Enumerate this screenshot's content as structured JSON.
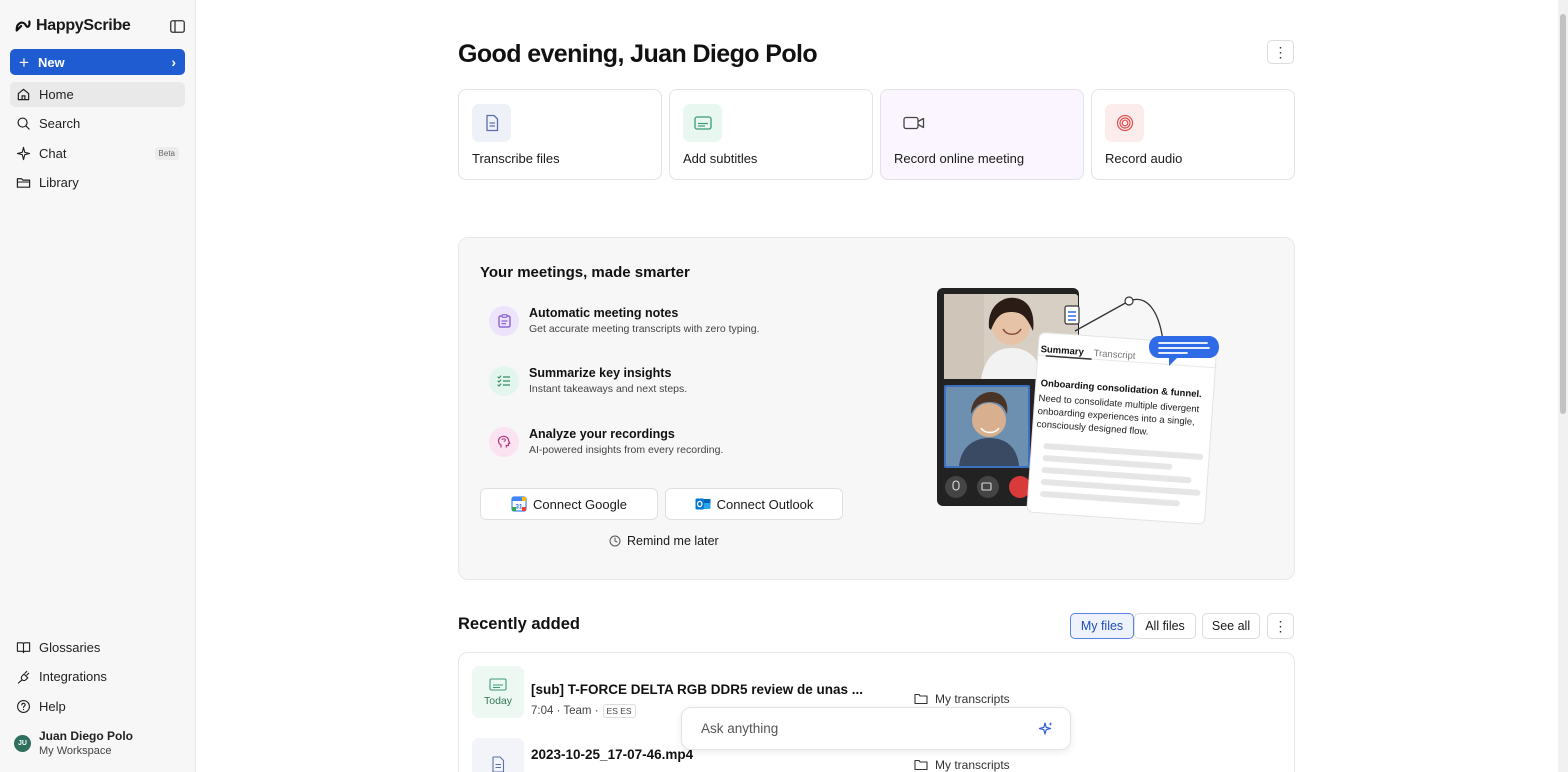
{
  "app": {
    "name": "HappyScribe"
  },
  "sidebar": {
    "new_label": "New",
    "nav": [
      {
        "label": "Home",
        "icon": "home-icon",
        "active": true
      },
      {
        "label": "Search",
        "icon": "search-icon"
      },
      {
        "label": "Chat",
        "icon": "sparkle-icon",
        "badge": "Beta"
      },
      {
        "label": "Library",
        "icon": "folder-icon"
      }
    ],
    "bottom_nav": [
      {
        "label": "Glossaries",
        "icon": "book-icon"
      },
      {
        "label": "Integrations",
        "icon": "plug-icon"
      },
      {
        "label": "Help",
        "icon": "help-icon"
      }
    ],
    "user": {
      "initials": "JU",
      "name": "Juan Diego Polo",
      "workspace": "My Workspace"
    }
  },
  "main": {
    "greeting": "Good evening, Juan Diego Polo",
    "actions": [
      {
        "label": "Transcribe files",
        "icon": "file-icon",
        "icon_bg": "#eef1f8",
        "icon_color": "#5b6fa8"
      },
      {
        "label": "Add subtitles",
        "icon": "subtitles-icon",
        "icon_bg": "#e9f7f1",
        "icon_color": "#3a9c76"
      },
      {
        "label": "Record online meeting",
        "icon": "video-camera-icon",
        "icon_bg": "#faf5fe",
        "icon_color": "#444"
      },
      {
        "label": "Record audio",
        "icon": "record-icon",
        "icon_bg": "#fdecec",
        "icon_color": "#e05252"
      }
    ],
    "promo": {
      "title": "Your meetings, made smarter",
      "features": [
        {
          "title": "Automatic meeting notes",
          "desc": "Get accurate meeting transcripts with zero typing.",
          "icon": "notes-icon",
          "bg": "#ede4fb",
          "color": "#7a4fc9"
        },
        {
          "title": "Summarize key insights",
          "desc": "Instant takeaways and next steps.",
          "icon": "checklist-icon",
          "bg": "#e3f6ee",
          "color": "#2f8a64"
        },
        {
          "title": "Analyze your recordings",
          "desc": "AI-powered insights from every recording.",
          "icon": "brain-icon",
          "bg": "#fbe3f1",
          "color": "#b0377c"
        }
      ],
      "connect_google": "Connect Google",
      "connect_outlook": "Connect Outlook",
      "remind_later": "Remind me later",
      "illustration": {
        "tab_summary": "Summary",
        "tab_transcript": "Transcript",
        "card_title": "Onboarding consolidation & funnel.",
        "card_body": "Need to consolidate multiple divergent onboarding experiences into a single, consciously designed flow."
      }
    },
    "recent": {
      "title": "Recently added",
      "filters": {
        "my_files": "My files",
        "all_files": "All files",
        "see_all": "See all"
      },
      "files": [
        {
          "name": "[sub] T-FORCE DELTA RGB DDR5 review de unas ...",
          "meta": "7:04 · Team ·",
          "lang": "ES ES",
          "date": "Today",
          "folder": "My transcripts",
          "icon": "subtitles-icon"
        },
        {
          "name": "2023-10-25_17-07-46.mp4",
          "meta": "",
          "lang": "",
          "date": "",
          "folder": "My transcripts",
          "icon": "file-icon"
        }
      ]
    },
    "ask": {
      "placeholder": "Ask anything"
    }
  }
}
